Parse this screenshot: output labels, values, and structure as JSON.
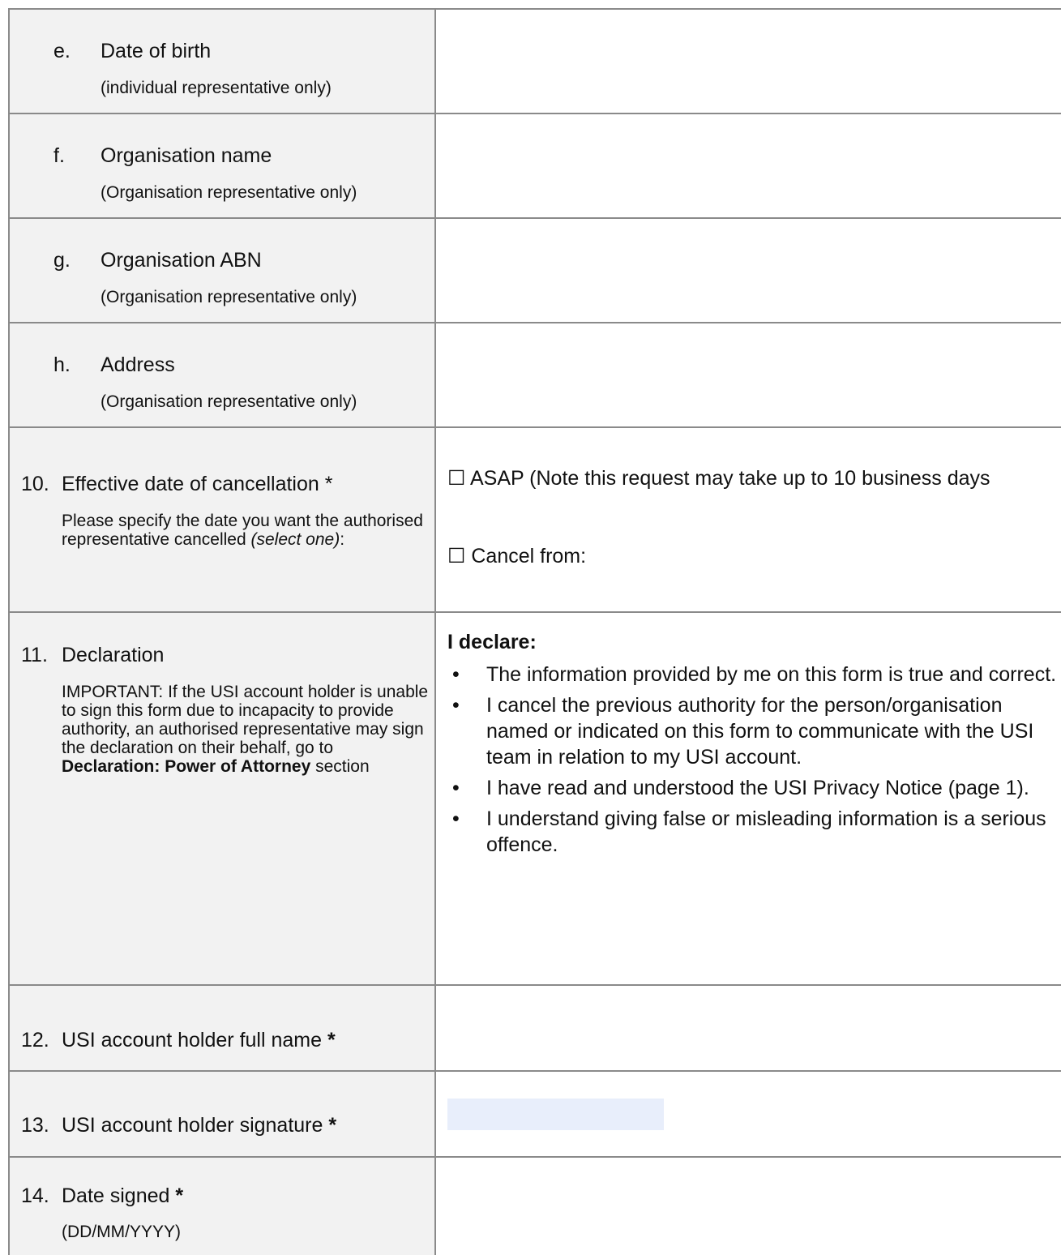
{
  "rows": {
    "e": {
      "letter": "e.",
      "title": "Date of birth",
      "note": "(individual representative only)"
    },
    "f": {
      "letter": "f.",
      "title": "Organisation name",
      "note": "(Organisation representative only)"
    },
    "g": {
      "letter": "g.",
      "title": "Organisation ABN",
      "note": "(Organisation representative only)"
    },
    "h": {
      "letter": "h.",
      "title": "Address",
      "note": "(Organisation representative only)"
    }
  },
  "q10": {
    "num": "10.",
    "title": "Effective date of cancellation *",
    "desc": "Please specify the date you want the authorised representative cancelled",
    "desc_italic": "(select one)",
    "desc_end": ":",
    "option1": "☐ ASAP (Note this request may take up to 10 business days",
    "option2": "☐ Cancel from:"
  },
  "q11": {
    "num": "11.",
    "title": "Declaration",
    "desc": "IMPORTANT: If the USI account holder is unable to sign this form due to incapacity to provide authority, an authorised representative may sign the declaration on their behalf, go to",
    "desc_bold": "Declaration: Power of Attorney",
    "desc_end": "section",
    "heading": "I declare:",
    "bullet": "•",
    "items": [
      "The information provided by me on this form is true and correct.",
      "I cancel the previous authority for the person/organisation named or indicated on this form to communicate with the USI team in relation to my USI account.",
      "I have read and understood the USI Privacy Notice (page 1).",
      "I understand giving false or misleading information is a serious offence."
    ]
  },
  "q12": {
    "num": "12.",
    "title": "USI account holder full name",
    "star": "*"
  },
  "q13": {
    "num": "13.",
    "title": "USI account holder signature",
    "star": "*"
  },
  "q14": {
    "num": "14.",
    "title": "Date signed",
    "star": "*",
    "note": "(DD/MM/YYYY)"
  }
}
